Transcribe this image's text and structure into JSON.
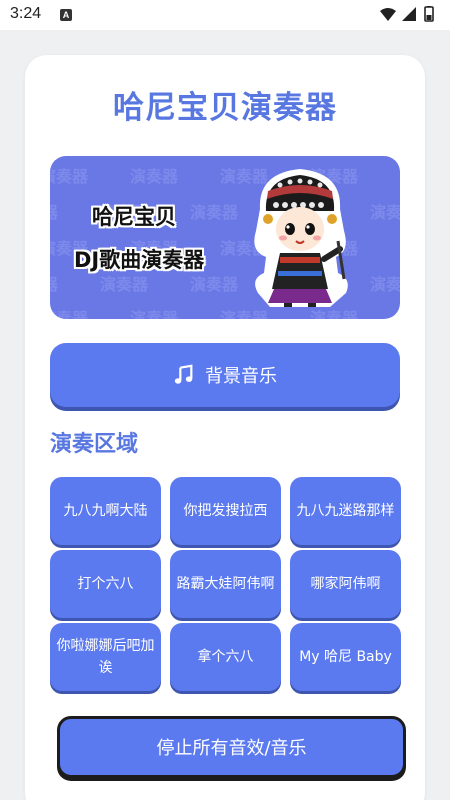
{
  "status_bar": {
    "time": "3:24",
    "notification_badge": "A"
  },
  "app": {
    "title": "哈尼宝贝演奏器",
    "accent_color": "#5877e0",
    "button_color": "#5b7af0"
  },
  "banner": {
    "line1": "哈尼宝贝",
    "line2": "DJ歌曲演奏器",
    "pattern_text": "演奏器"
  },
  "bgm_button": {
    "label": "背景音乐",
    "icon": "music-note-icon"
  },
  "play_area": {
    "title": "演奏区域",
    "pads": [
      "九八九啊大陆",
      "你把发搜拉西",
      "九八九迷路那样",
      "打个六八",
      "路霸大娃阿伟啊",
      "哪家阿伟啊",
      "你啦娜娜后吧加诶",
      "拿个六八",
      "My 哈尼 Baby"
    ]
  },
  "stop_button": {
    "label": "停止所有音效/音乐"
  }
}
